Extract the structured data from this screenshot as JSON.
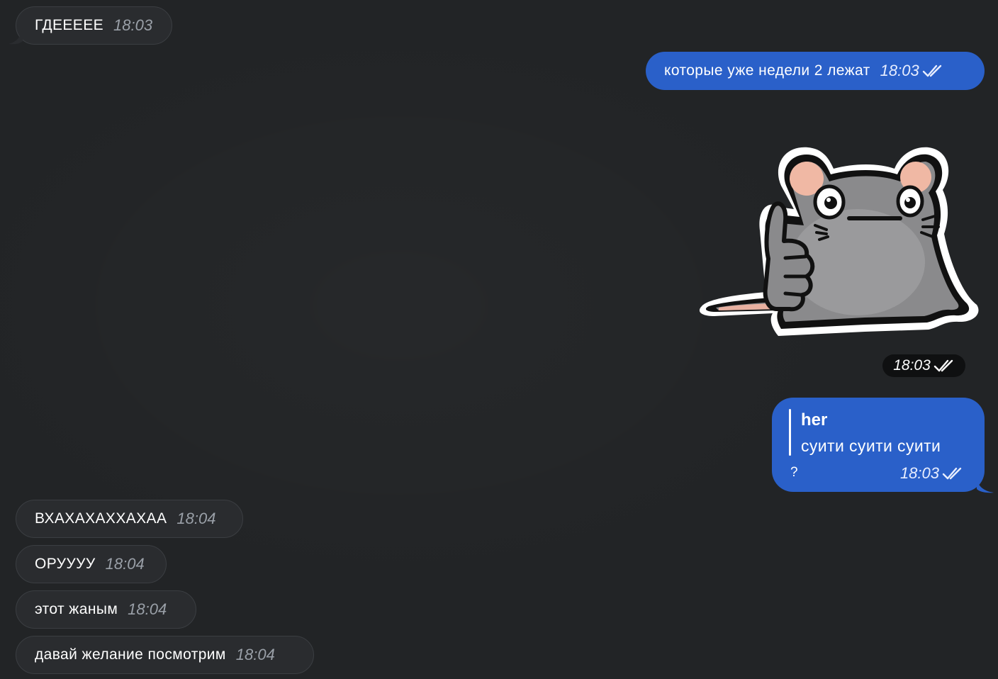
{
  "messages": [
    {
      "text": "ГДЕЕЕЕЕ",
      "time": "18:03"
    },
    {
      "text": "которые уже недели 2 лежат",
      "time": "18:03"
    },
    {
      "sticker": "rat-thumbs-up",
      "time": "18:03"
    },
    {
      "reply_author": "her",
      "reply_text": "суити суити суити",
      "text": "?",
      "time": "18:03"
    },
    {
      "text": "ВХАХАХАХХАХАА",
      "time": "18:04"
    },
    {
      "text": "ОРУУУУ",
      "time": "18:04"
    },
    {
      "text": "этот жаным",
      "time": "18:04"
    },
    {
      "text": "давай желание посмотрим",
      "time": "18:04"
    }
  ],
  "colors": {
    "background": "#222426",
    "incoming_bubble": "#2a2c2f",
    "outgoing_bubble": "#2a60c9"
  },
  "icons": {
    "read_receipt": "double-check-icon"
  }
}
